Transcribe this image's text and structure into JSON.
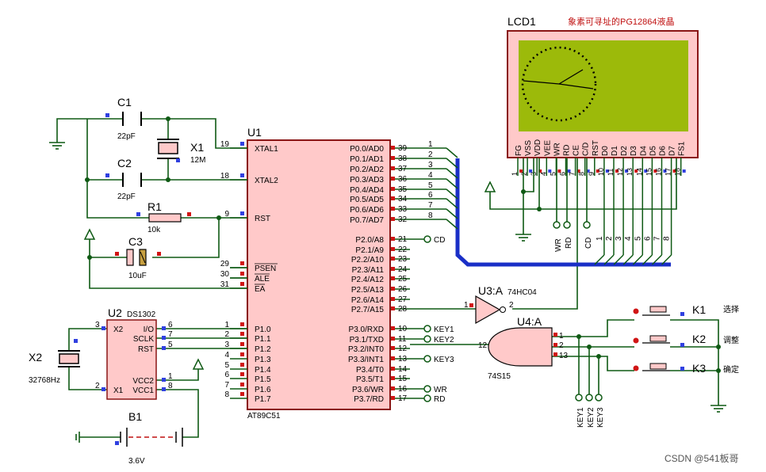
{
  "lcd": {
    "ref": "LCD1",
    "note": "象素可寻址的PG12864液晶",
    "pins": [
      "FG",
      "VSS",
      "VDD",
      "VEE",
      "WR",
      "RD",
      "CE",
      "C/D",
      "RST",
      "D0",
      "D1",
      "D2",
      "D3",
      "D4",
      "D5",
      "D6",
      "D7",
      "FS1"
    ],
    "pin_nums": [
      "1",
      "2",
      "3",
      "4",
      "5",
      "6",
      "7",
      "8",
      "9",
      "10",
      "11",
      "12",
      "13",
      "14",
      "15",
      "16",
      "17",
      "18"
    ]
  },
  "mcu": {
    "ref": "U1",
    "part": "AT89C51",
    "left_pins": [
      {
        "name": "XTAL1",
        "num": "19"
      },
      {
        "name": "XTAL2",
        "num": "18"
      },
      {
        "name": "RST",
        "num": "9"
      },
      {
        "name": "PSEN",
        "num": "29"
      },
      {
        "name": "ALE",
        "num": "30"
      },
      {
        "name": "EA",
        "num": "31"
      },
      {
        "name": "P1.0",
        "num": "1"
      },
      {
        "name": "P1.1",
        "num": "2"
      },
      {
        "name": "P1.2",
        "num": "3"
      },
      {
        "name": "P1.3",
        "num": "4"
      },
      {
        "name": "P1.4",
        "num": "5"
      },
      {
        "name": "P1.5",
        "num": "6"
      },
      {
        "name": "P1.6",
        "num": "7"
      },
      {
        "name": "P1.7",
        "num": "8"
      }
    ],
    "right_pins": [
      {
        "name": "P0.0/AD0",
        "num": "39"
      },
      {
        "name": "P0.1/AD1",
        "num": "38"
      },
      {
        "name": "P0.2/AD2",
        "num": "37"
      },
      {
        "name": "P0.3/AD3",
        "num": "36"
      },
      {
        "name": "P0.4/AD4",
        "num": "35"
      },
      {
        "name": "P0.5/AD5",
        "num": "34"
      },
      {
        "name": "P0.6/AD6",
        "num": "33"
      },
      {
        "name": "P0.7/AD7",
        "num": "32"
      },
      {
        "name": "P2.0/A8",
        "num": "21"
      },
      {
        "name": "P2.1/A9",
        "num": "22"
      },
      {
        "name": "P2.2/A10",
        "num": "23"
      },
      {
        "name": "P2.3/A11",
        "num": "24"
      },
      {
        "name": "P2.4/A12",
        "num": "25"
      },
      {
        "name": "P2.5/A13",
        "num": "26"
      },
      {
        "name": "P2.6/A14",
        "num": "27"
      },
      {
        "name": "P2.7/A15",
        "num": "28"
      },
      {
        "name": "P3.0/RXD",
        "num": "10"
      },
      {
        "name": "P3.1/TXD",
        "num": "11"
      },
      {
        "name": "P3.2/INT0",
        "num": "12"
      },
      {
        "name": "P3.3/INT1",
        "num": "13"
      },
      {
        "name": "P3.4/T0",
        "num": "14"
      },
      {
        "name": "P3.5/T1",
        "num": "15"
      },
      {
        "name": "P3.6/WR",
        "num": "16"
      },
      {
        "name": "P3.7/RD",
        "num": "17"
      }
    ],
    "bus_nums": [
      "1",
      "2",
      "3",
      "4",
      "5",
      "6",
      "7",
      "8"
    ]
  },
  "parts": {
    "c1": {
      "ref": "C1",
      "val": "22pF"
    },
    "c2": {
      "ref": "C2",
      "val": "22pF"
    },
    "x1": {
      "ref": "X1",
      "val": "12M"
    },
    "r1": {
      "ref": "R1",
      "val": "10k"
    },
    "c3": {
      "ref": "C3",
      "val": "10uF"
    },
    "u2": {
      "ref": "U2",
      "part": "DS1302",
      "pins": [
        "X2",
        "I/O",
        "SCLK",
        "RST",
        "VCC2",
        "X1",
        "VCC1"
      ],
      "nums": [
        "3",
        "6",
        "7",
        "5",
        "1",
        "2",
        "8"
      ]
    },
    "x2": {
      "ref": "X2",
      "val": "32768Hz"
    },
    "b1": {
      "ref": "B1",
      "val": "3.6V"
    },
    "u3": {
      "ref": "U3:A",
      "part": "74HC04",
      "in": "1",
      "out": "2"
    },
    "u4": {
      "ref": "U4:A",
      "part": "74S15",
      "ins": [
        "1",
        "2",
        "13"
      ],
      "out": "12"
    },
    "k1": {
      "ref": "K1",
      "label": "选择"
    },
    "k2": {
      "ref": "K2",
      "label": "调整"
    },
    "k3": {
      "ref": "K3",
      "label": "确定"
    }
  },
  "nets": {
    "cd": "CD",
    "wr": "WR",
    "rd": "RD",
    "key1": "KEY1",
    "key2": "KEY2",
    "key3": "KEY3",
    "lcd_wr": "WR",
    "lcd_rd": "RD",
    "lcd_cd": "CD",
    "bottom_keys": [
      "KEY1",
      "KEY2",
      "KEY3"
    ]
  },
  "watermark": "CSDN @541板哥",
  "colors": {
    "wire": "#0f5a14",
    "bus": "#1a2fc7",
    "chip": "#ffc9c9",
    "lcd_screen": "#9cba0a",
    "lcd_frame": "#ffc9c9"
  }
}
